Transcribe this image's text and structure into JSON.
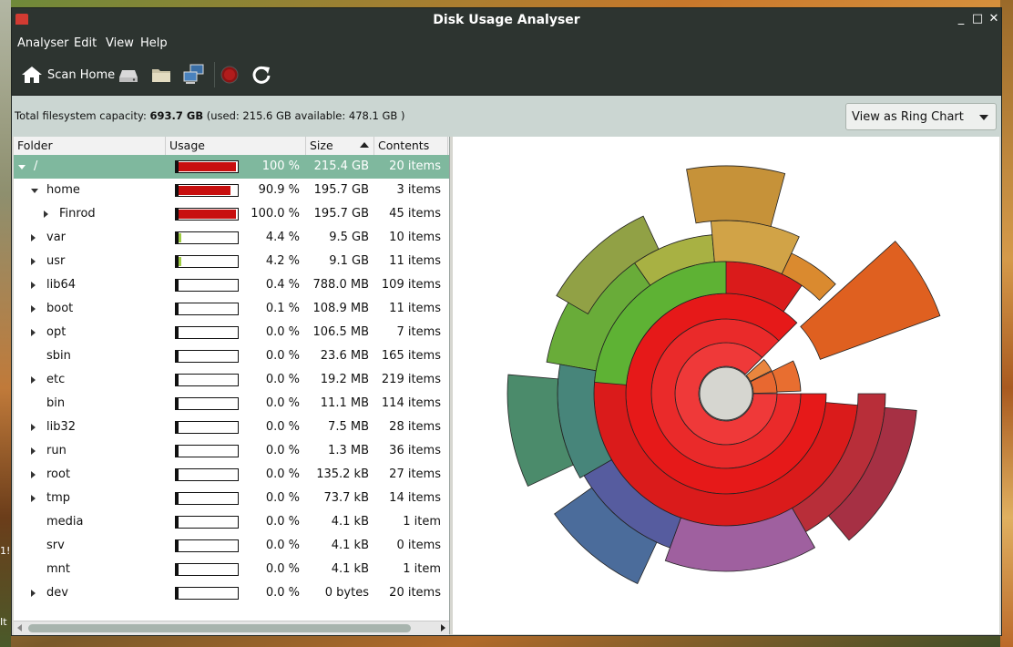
{
  "desktop": {
    "side_text_1": "1!",
    "side_text_2": "It"
  },
  "window": {
    "title": "Disk Usage Analyser"
  },
  "menu": {
    "items": [
      "Analyser",
      "Edit",
      "View",
      "Help"
    ]
  },
  "toolbar": {
    "scan_home_label": "Scan Home",
    "icons": [
      "home-icon",
      "drive-icon",
      "folder-icon",
      "network-icon",
      "stop-icon",
      "refresh-icon"
    ]
  },
  "info": {
    "prefix": "Total filesystem capacity: ",
    "capacity": "693.7 GB",
    "suffix": " (used: 215.6 GB available: 478.1 GB )"
  },
  "view_selector": {
    "value": "View as Ring Chart"
  },
  "tree": {
    "columns": {
      "folder": "Folder",
      "usage": "Usage",
      "size": "Size",
      "contents": "Contents"
    },
    "rows": [
      {
        "name": "/",
        "level": 0,
        "expander": "open",
        "usage": 1.0,
        "pct": "100 %",
        "size": "215.4 GB",
        "contents": "20 items",
        "selected": true
      },
      {
        "name": "home",
        "level": 1,
        "expander": "open",
        "usage": 0.909,
        "pct": "90.9 %",
        "size": "195.7 GB",
        "contents": "3 items"
      },
      {
        "name": "Finrod",
        "level": 2,
        "expander": "closed",
        "usage": 1.0,
        "pct": "100.0 %",
        "size": "195.7 GB",
        "contents": "45 items"
      },
      {
        "name": "var",
        "level": 1,
        "expander": "closed",
        "usage": 0.044,
        "pct": "4.4 %",
        "size": "9.5 GB",
        "contents": "10 items"
      },
      {
        "name": "usr",
        "level": 1,
        "expander": "closed",
        "usage": 0.042,
        "pct": "4.2 %",
        "size": "9.1 GB",
        "contents": "11 items"
      },
      {
        "name": "lib64",
        "level": 1,
        "expander": "closed",
        "usage": 0.004,
        "pct": "0.4 %",
        "size": "788.0 MB",
        "contents": "109 items"
      },
      {
        "name": "boot",
        "level": 1,
        "expander": "closed",
        "usage": 0.001,
        "pct": "0.1 %",
        "size": "108.9 MB",
        "contents": "11 items"
      },
      {
        "name": "opt",
        "level": 1,
        "expander": "closed",
        "usage": 0.0,
        "pct": "0.0 %",
        "size": "106.5 MB",
        "contents": "7 items"
      },
      {
        "name": "sbin",
        "level": 1,
        "expander": "none",
        "usage": 0.0,
        "pct": "0.0 %",
        "size": "23.6 MB",
        "contents": "165 items"
      },
      {
        "name": "etc",
        "level": 1,
        "expander": "closed",
        "usage": 0.0,
        "pct": "0.0 %",
        "size": "19.2 MB",
        "contents": "219 items"
      },
      {
        "name": "bin",
        "level": 1,
        "expander": "none",
        "usage": 0.0,
        "pct": "0.0 %",
        "size": "11.1 MB",
        "contents": "114 items"
      },
      {
        "name": "lib32",
        "level": 1,
        "expander": "closed",
        "usage": 0.0,
        "pct": "0.0 %",
        "size": "7.5 MB",
        "contents": "28 items"
      },
      {
        "name": "run",
        "level": 1,
        "expander": "closed",
        "usage": 0.0,
        "pct": "0.0 %",
        "size": "1.3 MB",
        "contents": "36 items"
      },
      {
        "name": "root",
        "level": 1,
        "expander": "closed",
        "usage": 0.0,
        "pct": "0.0 %",
        "size": "135.2 kB",
        "contents": "27 items"
      },
      {
        "name": "tmp",
        "level": 1,
        "expander": "closed",
        "usage": 0.0,
        "pct": "0.0 %",
        "size": "73.7 kB",
        "contents": "14 items"
      },
      {
        "name": "media",
        "level": 1,
        "expander": "none",
        "usage": 0.0,
        "pct": "0.0 %",
        "size": "4.1 kB",
        "contents": "1 item"
      },
      {
        "name": "srv",
        "level": 1,
        "expander": "none",
        "usage": 0.0,
        "pct": "0.0 %",
        "size": "4.1 kB",
        "contents": "0 items"
      },
      {
        "name": "mnt",
        "level": 1,
        "expander": "none",
        "usage": 0.0,
        "pct": "0.0 %",
        "size": "4.1 kB",
        "contents": "1 item"
      },
      {
        "name": "dev",
        "level": 1,
        "expander": "closed",
        "usage": 0.0,
        "pct": "0.0 %",
        "size": "0 bytes",
        "contents": "20 items"
      }
    ]
  },
  "colors": {
    "accent": "#7fb89e",
    "usage_bar": "#c80f0f",
    "usage_bar_low": "#9fcc44",
    "chrome": "#2d3430"
  }
}
